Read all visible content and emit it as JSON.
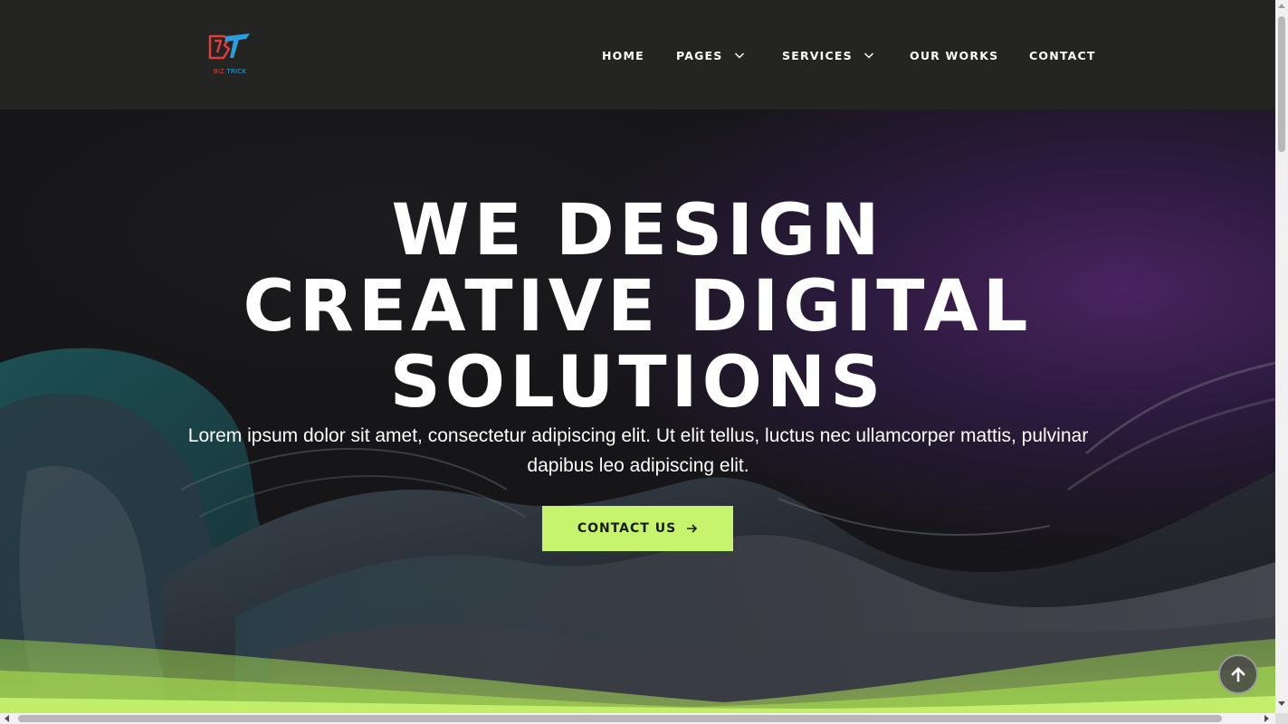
{
  "header": {
    "logo": {
      "text_part1": "BIZ",
      "text_part2": " TRICK",
      "colors": {
        "red": "#e43a3a",
        "blue": "#2a9fe0"
      }
    },
    "nav": [
      {
        "label": "HOME",
        "has_dropdown": false
      },
      {
        "label": "PAGES",
        "has_dropdown": true
      },
      {
        "label": "SERVICES",
        "has_dropdown": true
      },
      {
        "label": "OUR WORKS",
        "has_dropdown": false
      },
      {
        "label": "CONTACT",
        "has_dropdown": false
      }
    ]
  },
  "hero": {
    "title_lines": [
      "WE DESIGN",
      "CREATIVE DIGITAL",
      "SOLUTIONS"
    ],
    "subtitle": "Lorem ipsum dolor sit amet, consectetur adipiscing elit. Ut elit tellus, luctus nec ullamcorper mattis, pulvinar dapibus leo adipiscing elit.",
    "cta_label": "CONTACT US",
    "cta_icon": "arrow-right-icon"
  },
  "scroll_top_icon": "arrow-up-icon",
  "colors": {
    "header_bg": "#242522",
    "accent": "#c6f56d",
    "text": "#ffffff",
    "hero_purple": "#4a2360"
  }
}
